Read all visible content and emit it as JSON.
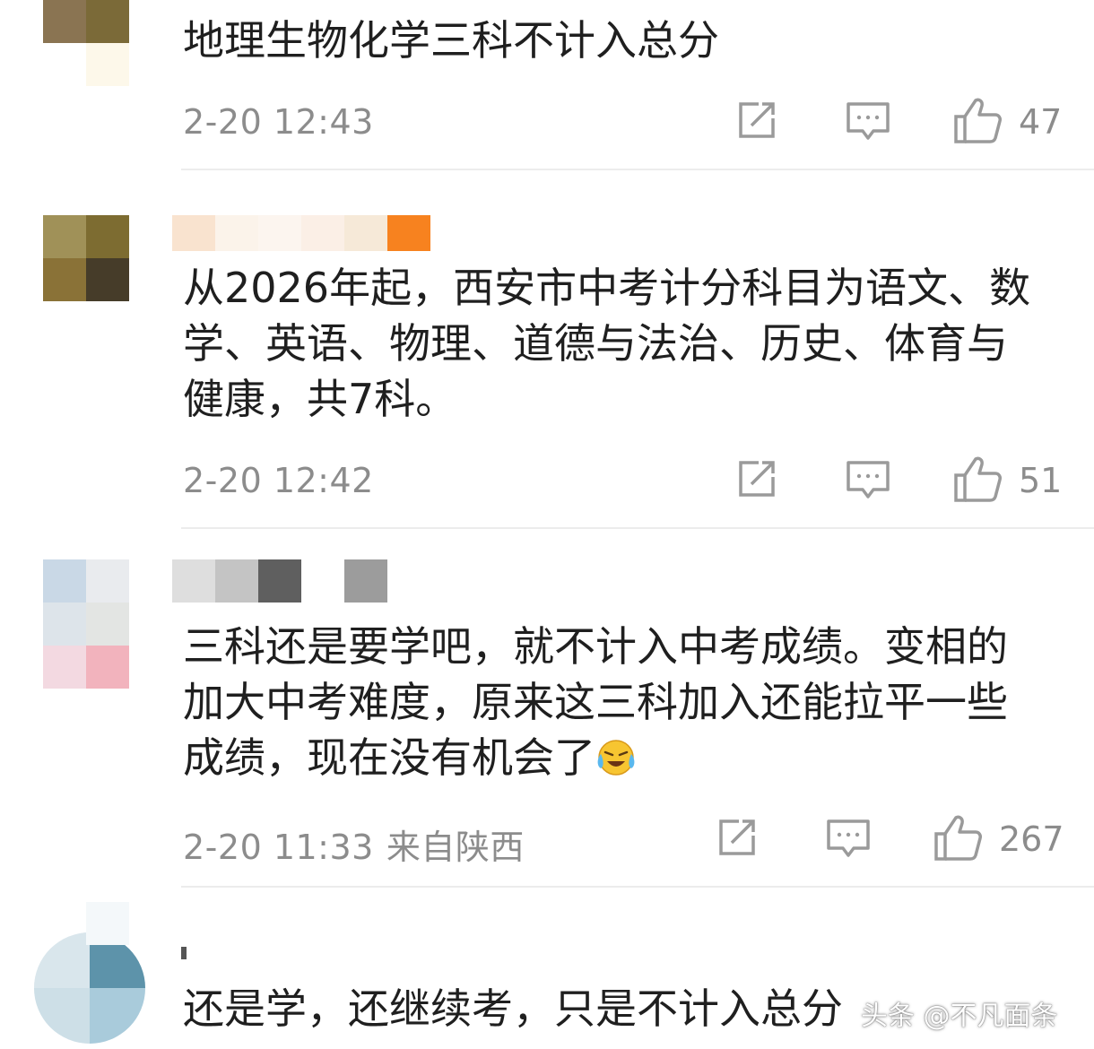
{
  "colors": {
    "text_primary": "#1f1f1f",
    "text_secondary": "#8c8c8c",
    "divider": "#ececec",
    "icon": "#9a9a9a"
  },
  "comments": [
    {
      "text": "地理生物化学三科不计入总分",
      "timestamp": "2-20 12:43",
      "location": "",
      "likes": "47",
      "icons": [
        "share-icon",
        "reply-icon",
        "thumbs-up-icon"
      ]
    },
    {
      "text": "从2026年起，西安市中考计分科目为语文、数学、英语、物理、道德与法治、历史、体育与健康，共7科。",
      "timestamp": "2-20 12:42",
      "location": "",
      "likes": "51",
      "icons": [
        "share-icon",
        "reply-icon",
        "thumbs-up-icon"
      ]
    },
    {
      "text": "三科还是要学吧，就不计入中考成绩。变相的加大中考难度，原来这三科加入还能拉平一些成绩，现在没有机会了",
      "emoji": "laughing-crying-emoji",
      "timestamp": "2-20 11:33",
      "location": "来自陕西",
      "likes": "267",
      "icons": [
        "share-icon",
        "reply-icon",
        "thumbs-up-icon"
      ]
    },
    {
      "text": "还是学，还继续考，只是不计入总分"
    }
  ],
  "watermark": {
    "text": "头条 @不凡面条"
  }
}
